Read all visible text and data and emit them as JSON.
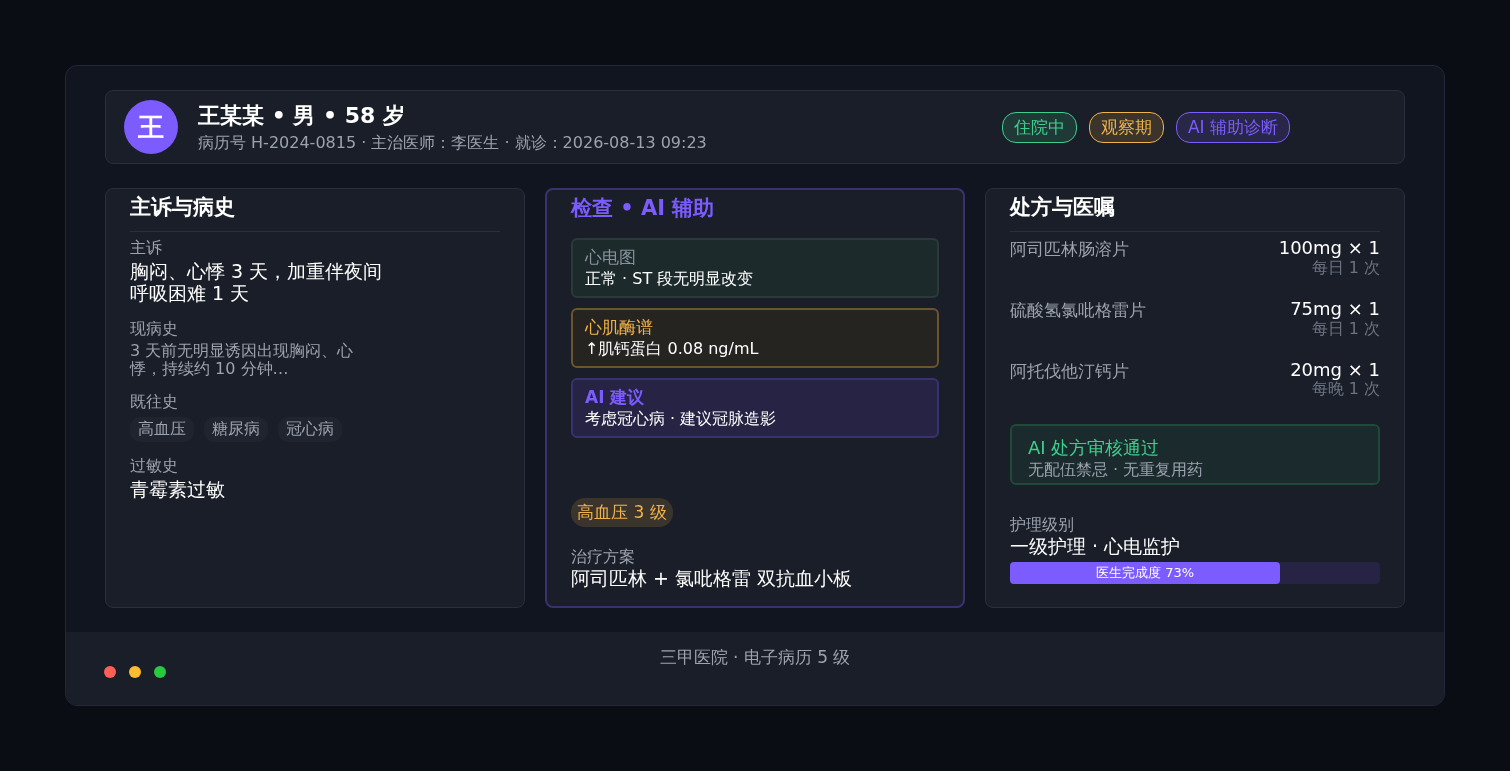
{
  "header": {
    "avatar": "王",
    "name": "王某某 • 男 • 58 岁",
    "meta": "病历号 H-2024-0815 · 主治医师：李医生 · 就诊：2026-08-13 09:23",
    "tags": [
      {
        "label": "住院中",
        "color": "#3ecf8e"
      },
      {
        "label": "观察期",
        "color": "#f0b34a"
      },
      {
        "label": "AI 辅助诊断",
        "color": "#7c5cff"
      }
    ]
  },
  "history": {
    "title": "主诉与病史",
    "sections": [
      {
        "kind": "text",
        "label": "主诉",
        "value": "胸闷、心悸 3 天，加重伴夜间呼吸困难 1 天",
        "strong": true
      },
      {
        "kind": "text",
        "label": "现病史",
        "value": "3 天前无明显诱因出现胸闷、心悸，持续约 10 分钟…",
        "strong": false
      },
      {
        "kind": "tags",
        "label": "既往史",
        "tags": [
          "高血压",
          "糖尿病",
          "冠心病"
        ]
      },
      {
        "kind": "text",
        "label": "过敏史",
        "value": "青霉素过敏",
        "strong": true
      }
    ]
  },
  "exams": {
    "title": "检查 • AI 辅助",
    "cards": [
      {
        "kind": "normal",
        "title": "心电图",
        "text": "正常 · ST 段无明显改变"
      },
      {
        "kind": "warning",
        "title": "心肌酶谱",
        "text": "↑肌钙蛋白 0.08 ng/mL"
      },
      {
        "kind": "ai",
        "title": "AI 建议",
        "text": "考虑冠心病 · 建议冠脉造影"
      }
    ],
    "diagnosis": "高血压 3 级",
    "plan": {
      "label": "治疗方案",
      "value": "阿司匹林 + 氯吡格雷 双抗血小板"
    }
  },
  "orders": {
    "title": "处方与医嘱",
    "meds": [
      {
        "name": "阿司匹林肠溶片",
        "dose": "100mg × 1",
        "frequency": "每日 1 次"
      },
      {
        "name": "硫酸氢氯吡格雷片",
        "dose": "75mg × 1",
        "frequency": "每日 1 次"
      },
      {
        "name": "阿托伐他汀钙片",
        "dose": "20mg × 1",
        "frequency": "每晚 1 次"
      }
    ],
    "review": {
      "title": "AI 处方审核通过",
      "text": "无配伍禁忌 · 无重复用药"
    },
    "nursing": {
      "label": "护理级别",
      "value": "一级护理 · 心电监护"
    },
    "progress": {
      "label": "医生完成度 73%",
      "level": 0.73
    }
  },
  "footer": {
    "text": "三甲医院 · 电子病历 5 级"
  }
}
